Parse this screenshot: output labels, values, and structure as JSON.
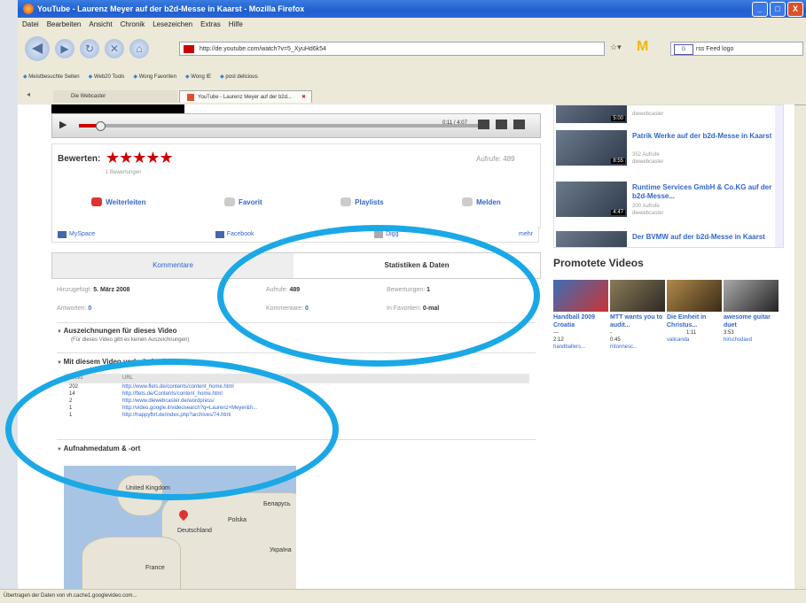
{
  "window": {
    "title": "YouTube - Laurenz Meyer auf der b2d-Messe in Kaarst - Mozilla Firefox",
    "buttons": [
      "_",
      "□",
      "X"
    ]
  },
  "menu": [
    "Datei",
    "Bearbeiten",
    "Ansicht",
    "Chronik",
    "Lesezeichen",
    "Extras",
    "Hilfe"
  ],
  "nav": {
    "url": "http://de.youtube.com/watch?v=5_XyuHd6k54",
    "search_placeholder": "rss Feed logo"
  },
  "bookmarks": [
    "Meistbesuchte Seiten",
    "Web20 Tools",
    "Wong Favoriten",
    "Wong IE",
    "post delicious"
  ],
  "tabs": [
    {
      "label": "Die Webcaster"
    },
    {
      "label": "YouTube - Laurenz Meyer auf der b2d..."
    }
  ],
  "player": {
    "time": "0:11 / 4:07",
    "progress": 0.05
  },
  "rating": {
    "label": "Bewerten:",
    "stars": "★★★★★",
    "count": "1 Bewertungen",
    "views_label": "Aufrufe:",
    "views": "489"
  },
  "actions": [
    "Weiterleiten",
    "Favorit",
    "Playlists",
    "Melden"
  ],
  "share": [
    "MySpace",
    "Facebook",
    "Digg",
    "mehr"
  ],
  "stat_tabs": [
    "Kommentare",
    "Statistiken & Daten"
  ],
  "stats": {
    "added_label": "Hinzugefügt:",
    "added": "5. März 2008",
    "views_label": "Aufrufe:",
    "views": "489",
    "ratings_label": "Bewertungen:",
    "ratings": "1",
    "replies_label": "Antworten:",
    "replies": "0",
    "comments_label": "Kommentare:",
    "comments": "0",
    "fav_label": "In Favoriten:",
    "fav": "0-mal"
  },
  "awards": {
    "title": "Auszeichnungen für dieses Video",
    "text": "(Für dieses Video gibt es keinen Auszeichnungen)"
  },
  "links": {
    "title": "Mit diesem Video verknüpfte Seiten",
    "head_clicks": "Klicks",
    "head_url": "URL",
    "rows": [
      {
        "clicks": "202",
        "url": "http://www.flets.de/contents/content_home.html"
      },
      {
        "clicks": "14",
        "url": "http://flets.de/Contents/content_home.html"
      },
      {
        "clicks": "2",
        "url": "http://www.diewebcaster.de/wordpress/"
      },
      {
        "clicks": "1",
        "url": "http://video.google.it/videosearch?q=Laurenz+Meyer&h..."
      },
      {
        "clicks": "1",
        "url": "http://happyflirt.de/index.php?archives/74.html"
      }
    ]
  },
  "recording": {
    "title": "Aufnahmedatum & -ort",
    "map_labels": [
      "United Kingdom",
      "Polska",
      "Deutschland",
      "France",
      "Беларусь",
      "Україна"
    ]
  },
  "related": [
    {
      "title": "",
      "meta1": "diewebcaster",
      "meta2": "",
      "dur": "5:00"
    },
    {
      "title": "Patrik Werke auf der b2d-Messe in Kaarst",
      "meta1": "352 Aufrufe",
      "meta2": "diewebcaster",
      "dur": "8:55"
    },
    {
      "title": "Runtime Services GmbH & Co.KG auf der b2d-Messe...",
      "meta1": "200 Aufrufe",
      "meta2": "diewebcaster",
      "dur": "4:47"
    },
    {
      "title": "Der BVMW auf der b2d-Messe in Kaarst",
      "meta1": "",
      "meta2": "",
      "dur": ""
    }
  ],
  "promo": {
    "title": "Promotete Videos",
    "items": [
      {
        "title": "Handball 2009 Croatia",
        "m1": "---",
        "m2": "2:12",
        "user": "handballers..."
      },
      {
        "title": "MTT wants you to audit...",
        "m1": "-",
        "m2": "0:45",
        "user": "mtonnesc..."
      },
      {
        "title": "Die Einheit in Christus...",
        "m1": "1:11",
        "m2": "",
        "user": "valicanda"
      },
      {
        "title": "awesome guitar duet",
        "m1": "3:53",
        "m2": "",
        "user": "hirschsdavd"
      }
    ]
  },
  "status": "Übertragen der Daten von vh.cache1.googlevideo.com...",
  "colors": {
    "oval": "#1ba8e6",
    "star": "#cc0000",
    "link": "#3366cc"
  }
}
